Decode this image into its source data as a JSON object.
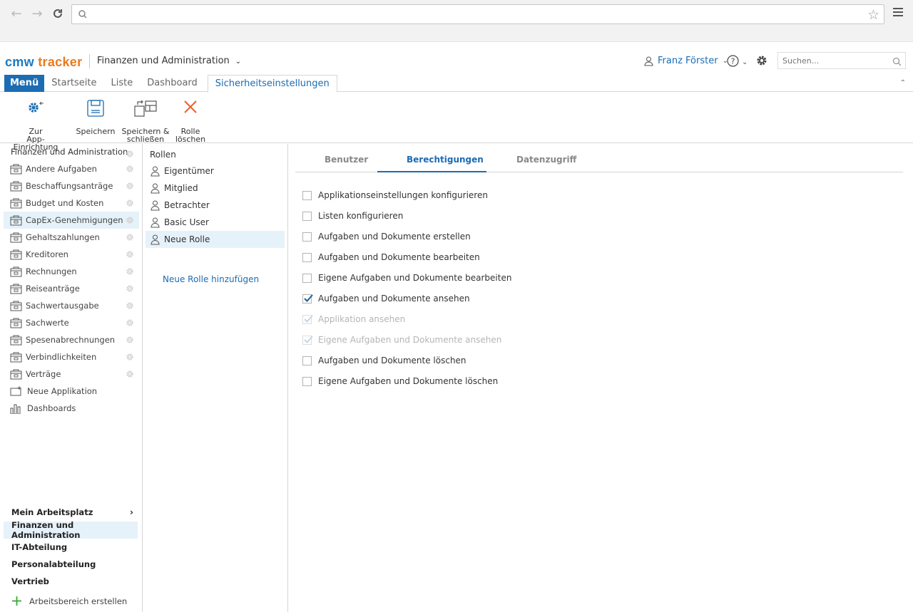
{
  "browser": {
    "address": ""
  },
  "header": {
    "logo_a": "cmw",
    "logo_b": "tracker",
    "workspace": "Finanzen und Administration",
    "user": "Franz Förster",
    "search_placeholder": "Suchen..."
  },
  "tabs": [
    {
      "label": "Menü"
    },
    {
      "label": "Startseite"
    },
    {
      "label": "Liste"
    },
    {
      "label": "Dashboard"
    },
    {
      "label": "Sicherheitseinstellungen"
    }
  ],
  "toolbar": {
    "back_line1": "Zur",
    "back_line2": "App-Einrichtung",
    "save": "Speichern",
    "save_close_line1": "Speichern &",
    "save_close_line2": "schließen",
    "delete_line1": "Rolle",
    "delete_line2": "löschen"
  },
  "sidebar": {
    "title": "Finanzen und Administration",
    "items": [
      {
        "label": "Andere Aufgaben"
      },
      {
        "label": "Beschaffungsanträge"
      },
      {
        "label": "Budget und Kosten"
      },
      {
        "label": "CapEx-Genehmigungen"
      },
      {
        "label": "Gehaltszahlungen"
      },
      {
        "label": "Kreditoren"
      },
      {
        "label": "Rechnungen"
      },
      {
        "label": "Reiseanträge"
      },
      {
        "label": "Sachwertausgabe"
      },
      {
        "label": "Sachwerte"
      },
      {
        "label": "Spesenabrechnungen"
      },
      {
        "label": "Verbindlichkeiten"
      },
      {
        "label": "Verträge"
      }
    ],
    "new_app": "Neue Applikation",
    "dashboards": "Dashboards",
    "workspaces": [
      {
        "label": "Mein Arbeitsplatz"
      },
      {
        "label": "Finanzen und Administration"
      },
      {
        "label": "IT-Abteilung"
      },
      {
        "label": "Personalabteilung"
      },
      {
        "label": "Vertrieb"
      }
    ],
    "add_workspace": "Arbeitsbereich erstellen"
  },
  "roles": {
    "title": "Rollen",
    "items": [
      {
        "label": "Eigentümer"
      },
      {
        "label": "Mitglied"
      },
      {
        "label": "Betrachter"
      },
      {
        "label": "Basic User"
      },
      {
        "label": "Neue Rolle"
      }
    ],
    "add": "Neue Rolle hinzufügen"
  },
  "content": {
    "tabs": [
      {
        "label": "Benutzer"
      },
      {
        "label": "Berechtigungen"
      },
      {
        "label": "Datenzugriff"
      }
    ],
    "permissions": [
      {
        "label": "Applikationseinstellungen konfigurieren",
        "checked": false,
        "disabled": false
      },
      {
        "label": "Listen konfigurieren",
        "checked": false,
        "disabled": false
      },
      {
        "label": "Aufgaben und Dokumente erstellen",
        "checked": false,
        "disabled": false
      },
      {
        "label": "Aufgaben und Dokumente bearbeiten",
        "checked": false,
        "disabled": false
      },
      {
        "label": "Eigene Aufgaben und Dokumente bearbeiten",
        "checked": false,
        "disabled": false
      },
      {
        "label": "Aufgaben und Dokumente ansehen",
        "checked": true,
        "disabled": false
      },
      {
        "label": "Applikation ansehen",
        "checked": true,
        "disabled": true
      },
      {
        "label": "Eigene Aufgaben und Dokumente ansehen",
        "checked": true,
        "disabled": true
      },
      {
        "label": "Aufgaben und Dokumente löschen",
        "checked": false,
        "disabled": false
      },
      {
        "label": "Eigene Aufgaben und Dokumente löschen",
        "checked": false,
        "disabled": false
      }
    ]
  },
  "colors": {
    "accent": "#1b6cb3",
    "brand_orange": "#ea7a1c",
    "selection": "#e6f2fa"
  }
}
